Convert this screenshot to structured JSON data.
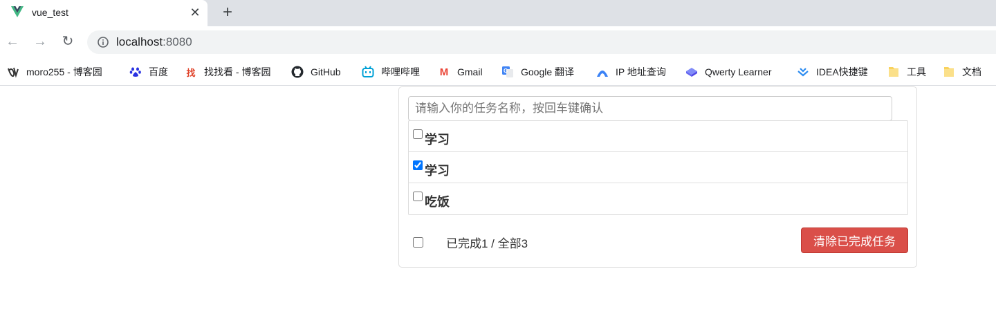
{
  "browser": {
    "tab": {
      "title": "vue_test"
    },
    "address": {
      "host": "localhost",
      "port": ":8080"
    },
    "bookmarks": [
      {
        "label": "moro255 - 博客园",
        "icon": "cnblogs-icon"
      },
      {
        "label": "百度",
        "icon": "baidu-paw-icon"
      },
      {
        "label": "找找看 - 博客园",
        "icon": "zhaozhaokan-icon",
        "icon_text": "找"
      },
      {
        "label": "GitHub",
        "icon": "github-icon"
      },
      {
        "label": "哔哩哔哩",
        "icon": "bilibili-icon"
      },
      {
        "label": "Gmail",
        "icon": "gmail-icon",
        "icon_text": "M"
      },
      {
        "label": "Google 翻译",
        "icon": "google-translate-icon"
      },
      {
        "label": "IP 地址查询",
        "icon": "ip-lookup-icon"
      },
      {
        "label": "Qwerty Learner",
        "icon": "keyboard-key-icon"
      },
      {
        "label": "IDEA快捷键",
        "icon": "idea-shortcuts-icon"
      },
      {
        "label": "工具",
        "icon": "folder-icon"
      },
      {
        "label": "文档",
        "icon": "folder-icon"
      }
    ]
  },
  "todo": {
    "input_placeholder": "请输入你的任务名称，按回车键确认",
    "tasks": [
      {
        "name": "学习",
        "done": false
      },
      {
        "name": "学习",
        "done": true
      },
      {
        "name": "吃饭",
        "done": false
      }
    ],
    "footer": {
      "stats": "已完成1 / 全部3",
      "clear_button": "清除已完成任务"
    }
  },
  "colors": {
    "danger_button": "#da4f49",
    "vue_green": "#41b883",
    "vue_dark": "#35495e"
  }
}
